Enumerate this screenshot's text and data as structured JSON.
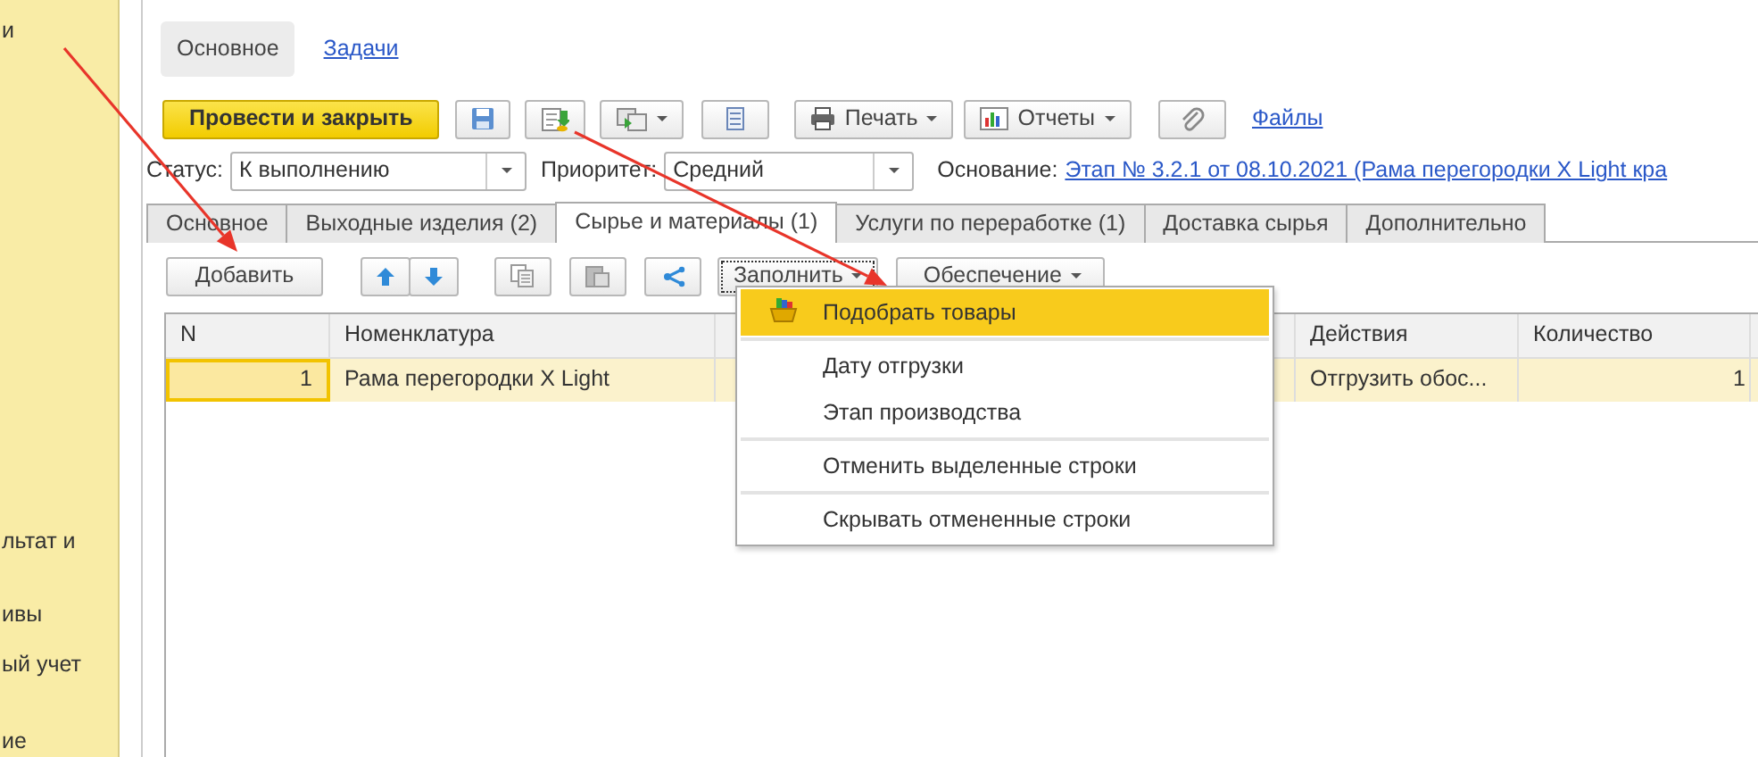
{
  "sidebar": {
    "items": [
      "и",
      "льтат и",
      "ивы",
      "ый учет",
      "ие"
    ]
  },
  "form_tabs": [
    {
      "label": "Основное",
      "selected": true
    },
    {
      "label": "Задачи",
      "selected": false
    }
  ],
  "toolbar": {
    "post_button": "Провести и закрыть",
    "print": "Печать",
    "reports": "Отчеты",
    "files": "Файлы"
  },
  "fields": {
    "status_label": "Статус:",
    "status": "К выполнению",
    "priority_label": "Приоритет:",
    "priority": "Средний",
    "basis_label": "Основание:",
    "basis": "Этап № 3.2.1 от 08.10.2021 (Рама перегородки X Light кра"
  },
  "tabs": [
    {
      "label": "Основное",
      "selected": false
    },
    {
      "label": "Выходные изделия (2)",
      "selected": false
    },
    {
      "label": "Сырье и материалы (1)",
      "selected": true
    },
    {
      "label": "Услуги по переработке (1)",
      "selected": false
    },
    {
      "label": "Доставка сырья",
      "selected": false
    },
    {
      "label": "Дополнительно",
      "selected": false
    }
  ],
  "table_toolbar": {
    "add": "Добавить",
    "fill": "Заполнить",
    "provision": "Обеспечение"
  },
  "table": {
    "columns": [
      "N",
      "Номенклатура",
      "Действия",
      "Количество"
    ],
    "rows": [
      {
        "n": "1",
        "nomenclature": "Рама перегородки X Light",
        "actions": "Отгрузить обос...",
        "quantity": "1",
        "selected": true
      }
    ]
  },
  "fill_menu": {
    "groups": [
      [
        {
          "label": "Подобрать товары",
          "selected": true,
          "icon": true
        }
      ],
      [
        {
          "label": "Дату отгрузки",
          "selected": false
        },
        {
          "label": "Этап производства",
          "selected": false
        }
      ],
      [
        {
          "label": "Отменить выделенные строки",
          "selected": false
        }
      ],
      [
        {
          "label": "Скрывать отмененные строки",
          "selected": false
        }
      ]
    ]
  }
}
